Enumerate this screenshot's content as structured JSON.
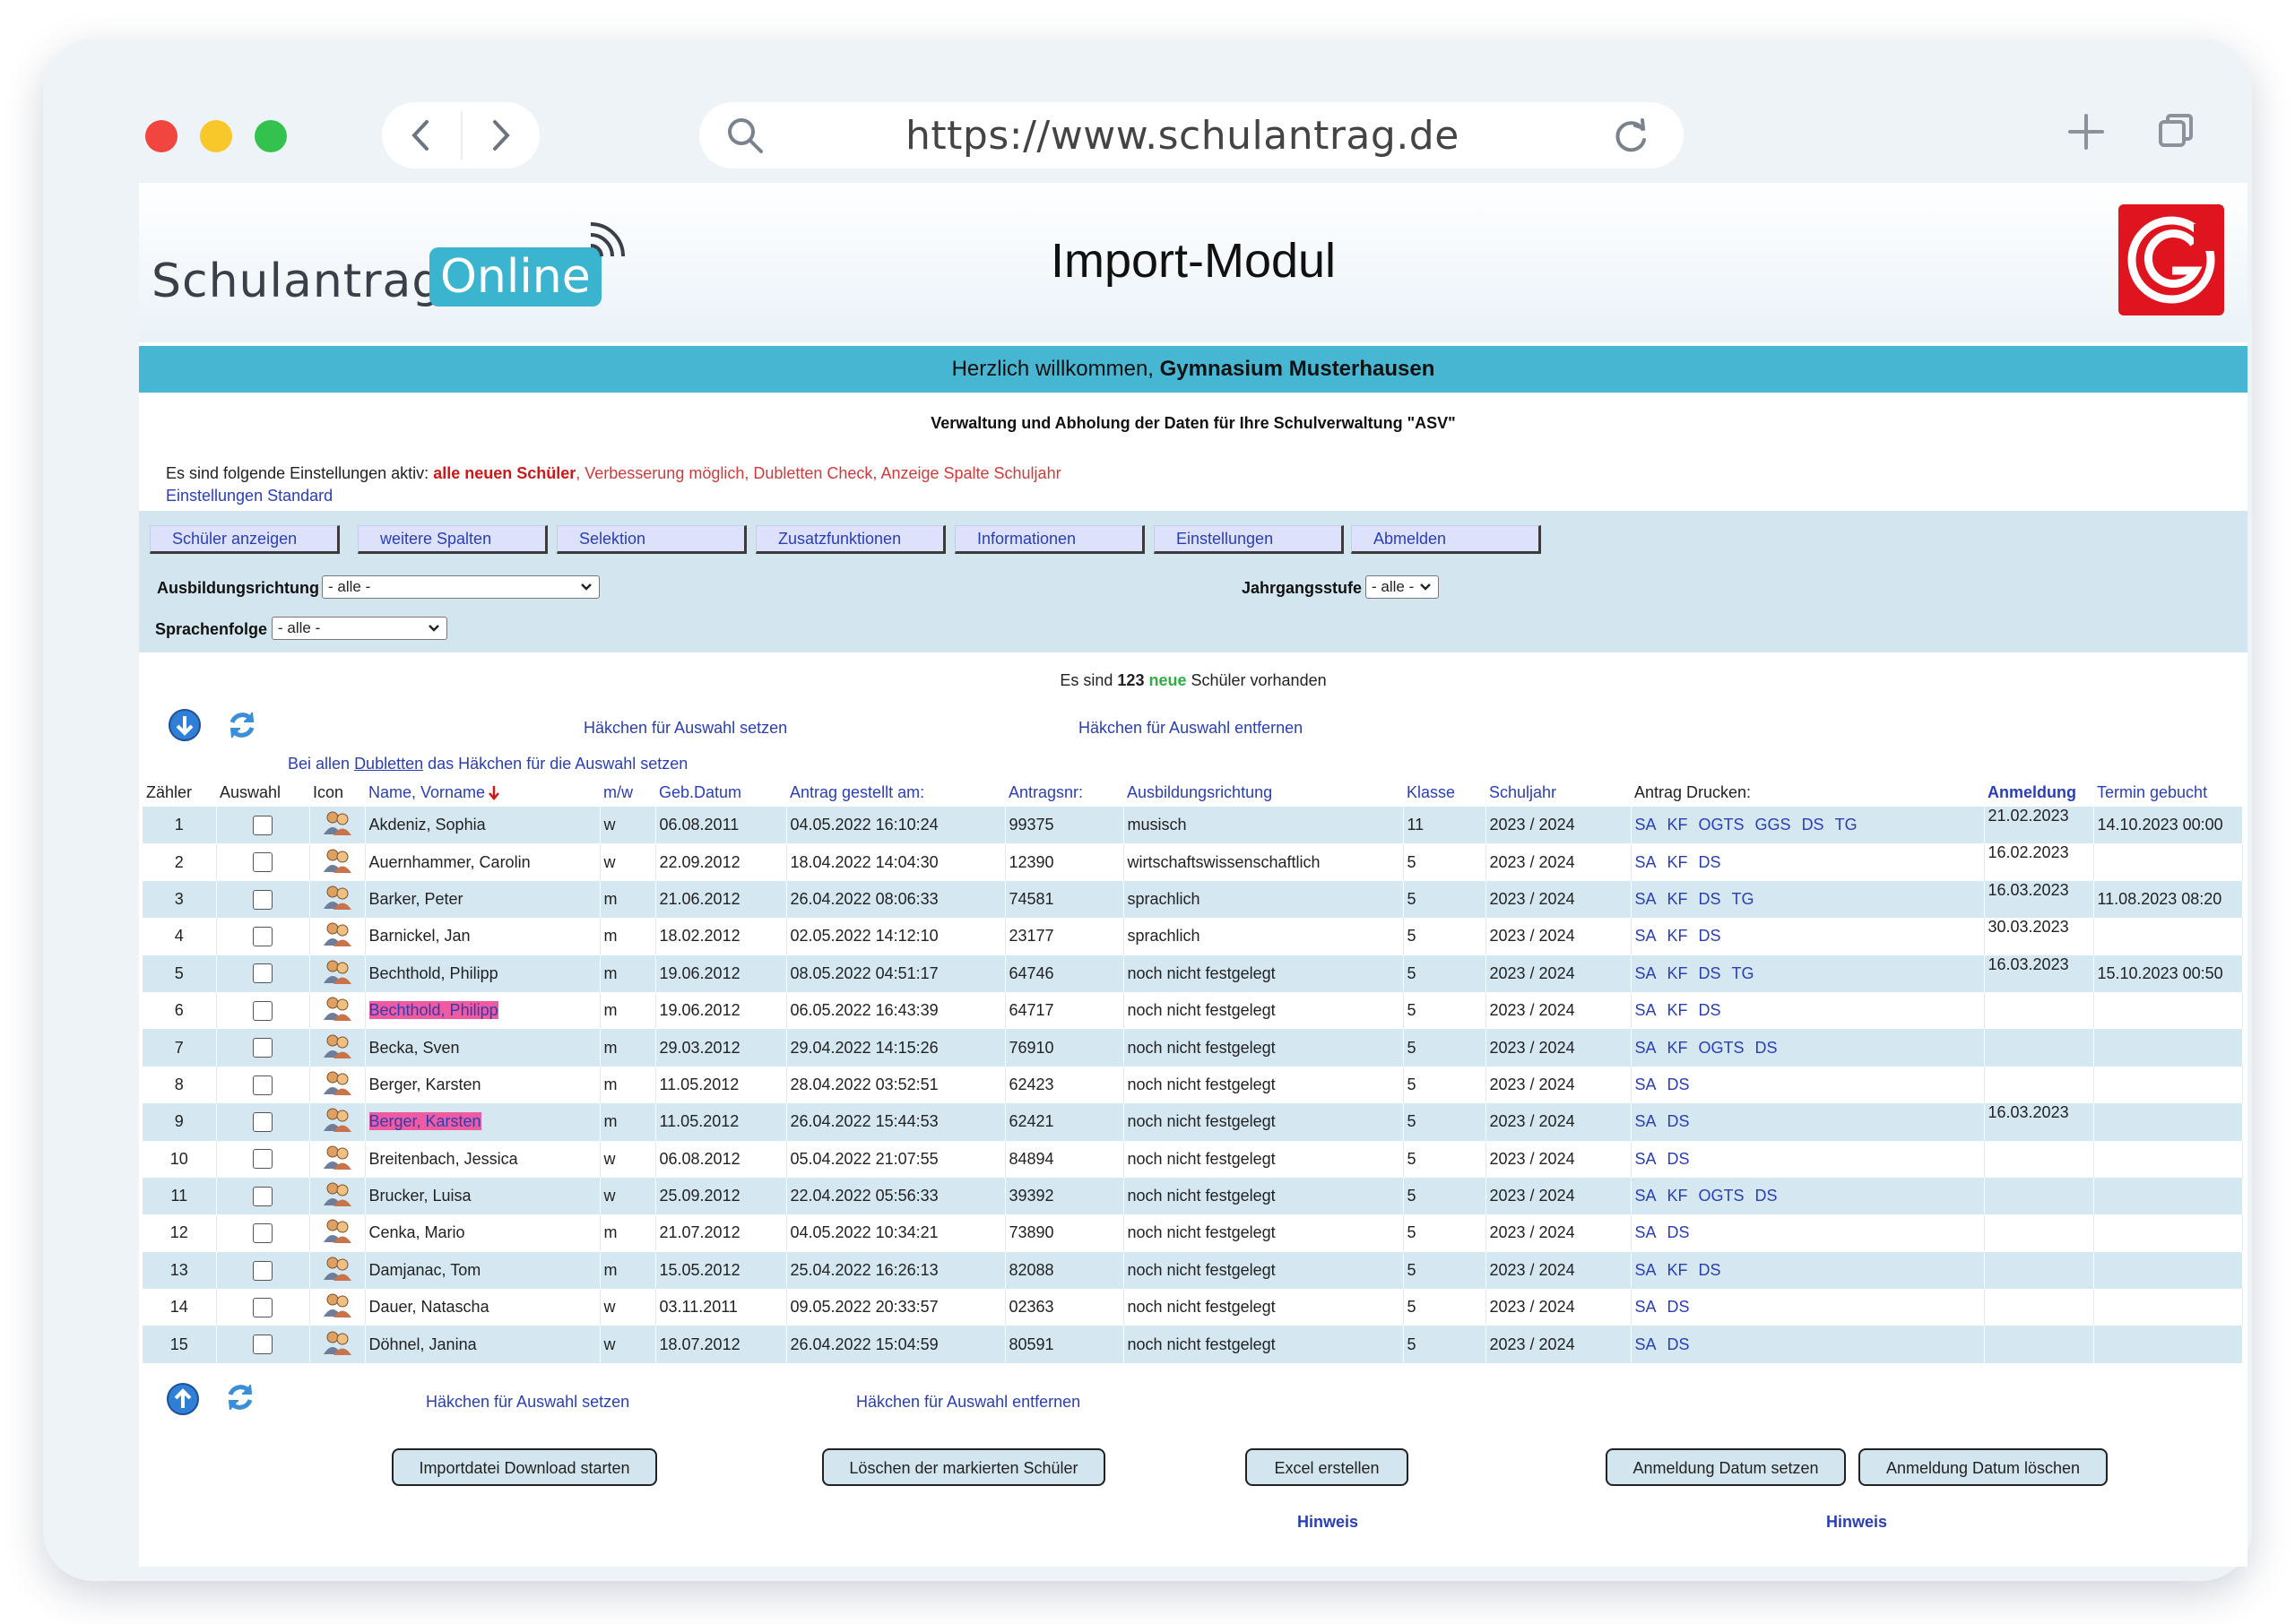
{
  "browser": {
    "url": "https://www.schulantrag.de"
  },
  "header": {
    "logo_part1": "Schulantrag",
    "logo_part2": "Online",
    "title": "Import-Modul"
  },
  "welcome": {
    "prefix": "Herzlich willkommen, ",
    "school": "Gymnasium Musterhausen"
  },
  "subtitle": "Verwaltung und Abholung der Daten für Ihre Schulverwaltung \"ASV\"",
  "settings": {
    "prefix": "Es sind folgende Einstellungen aktiv: ",
    "highlight": "alle neuen Schüler",
    "rest": ", Verbesserung möglich, Dubletten Check, Anzeige Spalte Schuljahr",
    "standard_link": "Einstellungen Standard"
  },
  "menu": [
    "Schüler anzeigen",
    "weitere Spalten",
    "Selektion",
    "Zusatzfunktionen",
    "Informationen",
    "Einstellungen",
    "Abmelden"
  ],
  "filters": {
    "ausbildung_label": "Ausbildungsrichtung",
    "ausbildung_value": "- alle -",
    "jahrgang_label": "Jahrgangsstufe",
    "jahrgang_value": "- alle -",
    "sprachen_label": "Sprachenfolge",
    "sprachen_value": "- alle -"
  },
  "count": {
    "prefix": "Es sind ",
    "number": "123",
    "neue": "neue",
    "suffix": " Schüler vorhanden"
  },
  "actions": {
    "set_checks": "Häkchen für Auswahl setzen",
    "remove_checks": "Häkchen für Auswahl entfernen",
    "dublette_prefix": "Bei allen ",
    "dublette_link": "Dubletten",
    "dublette_suffix": " das Häkchen für die Auswahl setzen"
  },
  "table": {
    "headers": {
      "zaehler": "Zähler",
      "auswahl": "Auswahl",
      "icon": "Icon",
      "name": "Name, Vorname",
      "mw": "m/w",
      "geb": "Geb.Datum",
      "antrag": "Antrag gestellt am:",
      "nr": "Antragsnr:",
      "ausbildung": "Ausbildungsrichtung",
      "klasse": "Klasse",
      "schuljahr": "Schuljahr",
      "drucken": "Antrag Drucken:",
      "anmeldung": "Anmeldung",
      "termin": "Termin gebucht"
    },
    "rows": [
      {
        "n": "1",
        "name": "Akdeniz, Sophia",
        "mw": "w",
        "geb": "06.08.2011",
        "antrag": "04.05.2022 16:10:24",
        "nr": "99375",
        "richtung": "musisch",
        "klasse": "11",
        "sj": "2023 / 2024",
        "docs": [
          "SA",
          "KF",
          "OGTS",
          "GGS",
          "DS",
          "TG"
        ],
        "anm": "21.02.2023",
        "termin": "14.10.2023 00:00",
        "dup": false
      },
      {
        "n": "2",
        "name": "Auernhammer, Carolin",
        "mw": "w",
        "geb": "22.09.2012",
        "antrag": "18.04.2022 14:04:30",
        "nr": "12390",
        "richtung": "wirtschaftswissenschaftlich",
        "klasse": "5",
        "sj": "2023 / 2024",
        "docs": [
          "SA",
          "KF",
          "DS"
        ],
        "anm": "16.02.2023",
        "termin": "",
        "dup": false
      },
      {
        "n": "3",
        "name": "Barker, Peter",
        "mw": "m",
        "geb": "21.06.2012",
        "antrag": "26.04.2022 08:06:33",
        "nr": "74581",
        "richtung": "sprachlich",
        "klasse": "5",
        "sj": "2023 / 2024",
        "docs": [
          "SA",
          "KF",
          "DS",
          "TG"
        ],
        "anm": "16.03.2023",
        "termin": "11.08.2023 08:20",
        "dup": false
      },
      {
        "n": "4",
        "name": "Barnickel, Jan",
        "mw": "m",
        "geb": "18.02.2012",
        "antrag": "02.05.2022 14:12:10",
        "nr": "23177",
        "richtung": "sprachlich",
        "klasse": "5",
        "sj": "2023 / 2024",
        "docs": [
          "SA",
          "KF",
          "DS"
        ],
        "anm": "30.03.2023",
        "termin": "",
        "dup": false
      },
      {
        "n": "5",
        "name": "Bechthold, Philipp",
        "mw": "m",
        "geb": "19.06.2012",
        "antrag": "08.05.2022 04:51:17",
        "nr": "64746",
        "richtung": "noch nicht festgelegt",
        "klasse": "5",
        "sj": "2023 / 2024",
        "docs": [
          "SA",
          "KF",
          "DS",
          "TG"
        ],
        "anm": "16.03.2023",
        "termin": "15.10.2023 00:50",
        "dup": false
      },
      {
        "n": "6",
        "name": "Bechthold, Philipp",
        "mw": "m",
        "geb": "19.06.2012",
        "antrag": "06.05.2022 16:43:39",
        "nr": "64717",
        "richtung": "noch nicht festgelegt",
        "klasse": "5",
        "sj": "2023 / 2024",
        "docs": [
          "SA",
          "KF",
          "DS"
        ],
        "anm": "",
        "termin": "",
        "dup": true
      },
      {
        "n": "7",
        "name": "Becka, Sven",
        "mw": "m",
        "geb": "29.03.2012",
        "antrag": "29.04.2022 14:15:26",
        "nr": "76910",
        "richtung": "noch nicht festgelegt",
        "klasse": "5",
        "sj": "2023 / 2024",
        "docs": [
          "SA",
          "KF",
          "OGTS",
          "DS"
        ],
        "anm": "",
        "termin": "",
        "dup": false
      },
      {
        "n": "8",
        "name": "Berger, Karsten",
        "mw": "m",
        "geb": "11.05.2012",
        "antrag": "28.04.2022 03:52:51",
        "nr": "62423",
        "richtung": "noch nicht festgelegt",
        "klasse": "5",
        "sj": "2023 / 2024",
        "docs": [
          "SA",
          "DS"
        ],
        "anm": "",
        "termin": "",
        "dup": false
      },
      {
        "n": "9",
        "name": "Berger, Karsten",
        "mw": "m",
        "geb": "11.05.2012",
        "antrag": "26.04.2022 15:44:53",
        "nr": "62421",
        "richtung": "noch nicht festgelegt",
        "klasse": "5",
        "sj": "2023 / 2024",
        "docs": [
          "SA",
          "DS"
        ],
        "anm": "16.03.2023",
        "termin": "",
        "dup": true
      },
      {
        "n": "10",
        "name": "Breitenbach, Jessica",
        "mw": "w",
        "geb": "06.08.2012",
        "antrag": "05.04.2022 21:07:55",
        "nr": "84894",
        "richtung": "noch nicht festgelegt",
        "klasse": "5",
        "sj": "2023 / 2024",
        "docs": [
          "SA",
          "DS"
        ],
        "anm": "",
        "termin": "",
        "dup": false
      },
      {
        "n": "11",
        "name": "Brucker, Luisa",
        "mw": "w",
        "geb": "25.09.2012",
        "antrag": "22.04.2022 05:56:33",
        "nr": "39392",
        "richtung": "noch nicht festgelegt",
        "klasse": "5",
        "sj": "2023 / 2024",
        "docs": [
          "SA",
          "KF",
          "OGTS",
          "DS"
        ],
        "anm": "",
        "termin": "",
        "dup": false
      },
      {
        "n": "12",
        "name": "Cenka, Mario",
        "mw": "m",
        "geb": "21.07.2012",
        "antrag": "04.05.2022 10:34:21",
        "nr": "73890",
        "richtung": "noch nicht festgelegt",
        "klasse": "5",
        "sj": "2023 / 2024",
        "docs": [
          "SA",
          "DS"
        ],
        "anm": "",
        "termin": "",
        "dup": false
      },
      {
        "n": "13",
        "name": "Damjanac, Tom",
        "mw": "m",
        "geb": "15.05.2012",
        "antrag": "25.04.2022 16:26:13",
        "nr": "82088",
        "richtung": "noch nicht festgelegt",
        "klasse": "5",
        "sj": "2023 / 2024",
        "docs": [
          "SA",
          "KF",
          "DS"
        ],
        "anm": "",
        "termin": "",
        "dup": false
      },
      {
        "n": "14",
        "name": "Dauer, Natascha",
        "mw": "w",
        "geb": "03.11.2011",
        "antrag": "09.05.2022 20:33:57",
        "nr": "02363",
        "richtung": "noch nicht festgelegt",
        "klasse": "5",
        "sj": "2023 / 2024",
        "docs": [
          "SA",
          "DS"
        ],
        "anm": "",
        "termin": "",
        "dup": false
      },
      {
        "n": "15",
        "name": "Döhnel, Janina",
        "mw": "w",
        "geb": "18.07.2012",
        "antrag": "26.04.2022 15:04:59",
        "nr": "80591",
        "richtung": "noch nicht festgelegt",
        "klasse": "5",
        "sj": "2023 / 2024",
        "docs": [
          "SA",
          "DS"
        ],
        "anm": "",
        "termin": "",
        "dup": false
      }
    ]
  },
  "bottom": {
    "download": "Importdatei Download starten",
    "delete": "Löschen der markierten Schüler",
    "excel": "Excel erstellen",
    "set_date": "Anmeldung Datum setzen",
    "delete_date": "Anmeldung Datum löschen",
    "hinweis": "Hinweis"
  },
  "colors": {
    "accent": "#47b6d3",
    "panel": "#d3e6ef",
    "link": "#2a3fb5",
    "duplicate": "#ef5aa0",
    "brand_red": "#e0141e"
  }
}
